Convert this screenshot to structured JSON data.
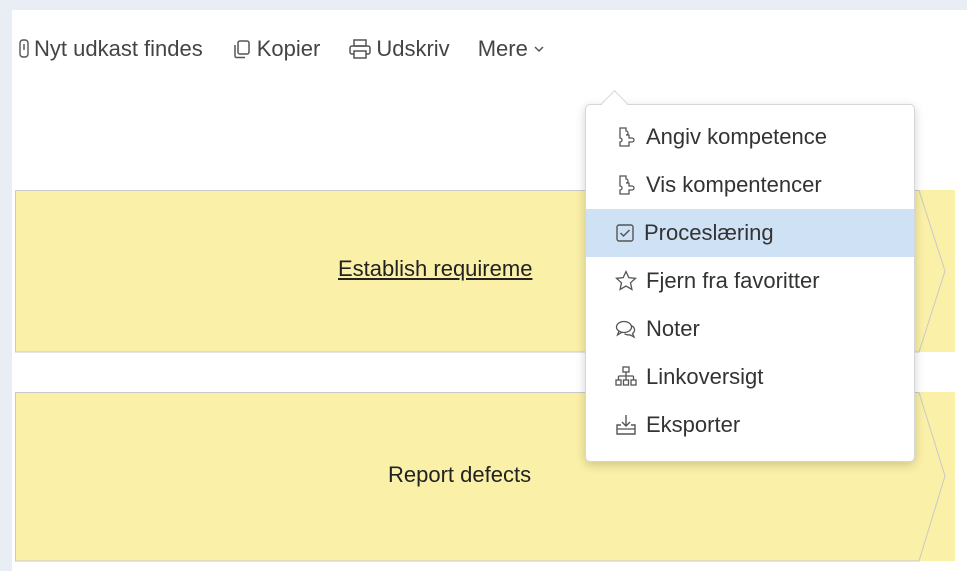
{
  "toolbar": {
    "draft_label": "Nyt udkast findes",
    "copy_label": "Kopier",
    "print_label": "Udskriv",
    "more_label": "Mere"
  },
  "process": {
    "step1_label": "Establish requireme",
    "step2_label": "Report defects"
  },
  "menu": {
    "items": [
      {
        "label": "Angiv kompetence",
        "icon": "puzzle-icon"
      },
      {
        "label": "Vis kompentencer",
        "icon": "puzzle-icon"
      },
      {
        "label": "Proceslæring",
        "icon": "checkbox-icon",
        "active": true
      },
      {
        "label": "Fjern fra favoritter",
        "icon": "star-icon"
      },
      {
        "label": "Noter",
        "icon": "chat-icon"
      },
      {
        "label": "Linkoversigt",
        "icon": "sitemap-icon"
      },
      {
        "label": "Eksporter",
        "icon": "export-icon"
      }
    ]
  },
  "colors": {
    "chevron_fill": "#faf0a8",
    "chevron_border": "#c9c9c9",
    "active_item": "#cfe2f5"
  }
}
